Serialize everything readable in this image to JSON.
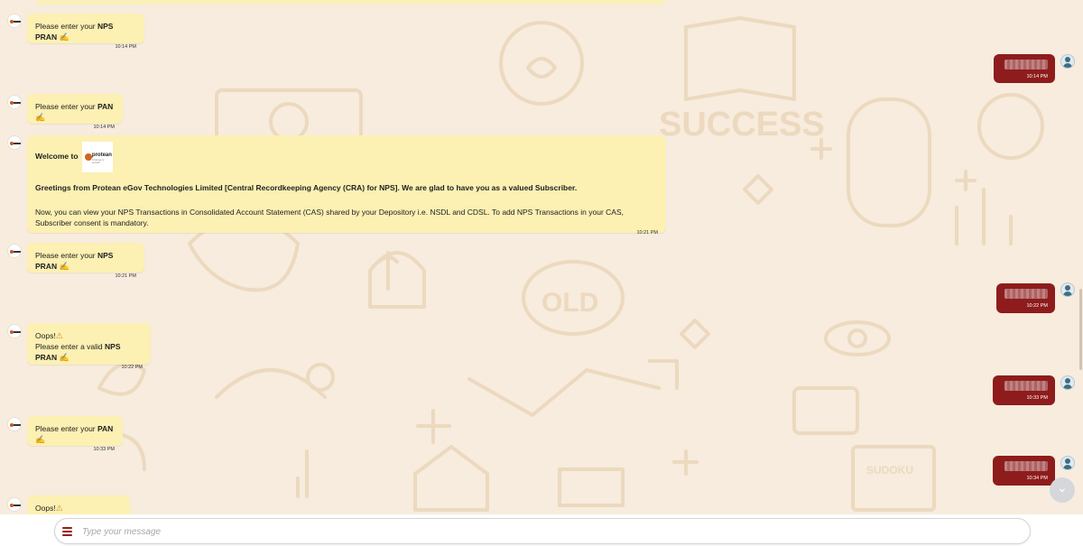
{
  "chat": {
    "messages": [
      {
        "sender": "bot",
        "pre": "Please enter your ",
        "bold": "NPS PRAN",
        "emoji": "✍",
        "time": "10:14 PM"
      },
      {
        "sender": "user",
        "time": "10:14 PM"
      },
      {
        "sender": "bot",
        "pre": "Please enter your ",
        "bold": "PAN",
        "emoji": "✍",
        "time": "10:14 PM"
      },
      {
        "sender": "bot",
        "welcome_text": "Welcome to",
        "logo_text": "protean",
        "logo_sub": "Change is growth",
        "greeting": "Greetings from Protean eGov Technologies Limited [Central Recordkeeping Agency (CRA) for NPS]. We are glad to have you as a valued Subscriber.",
        "body": "Now, you can view your NPS Transactions in Consolidated Account Statement (CAS) shared by your Depository i.e. NSDL and CDSL. To add NPS Transactions in your CAS, Subscriber consent is mandatory.",
        "time": "10:21 PM"
      },
      {
        "sender": "bot",
        "pre": "Please enter your ",
        "bold": "NPS PRAN",
        "emoji": "✍",
        "time": "10:21 PM"
      },
      {
        "sender": "user",
        "time": "10:22 PM"
      },
      {
        "sender": "bot",
        "oops": "Oops!",
        "oops_emoji": "⚠",
        "pre": "Please enter a valid ",
        "bold": "NPS PRAN",
        "emoji": "✍",
        "time": "10:22 PM"
      },
      {
        "sender": "user",
        "time": "10:33 PM"
      },
      {
        "sender": "bot",
        "pre": "Please enter your ",
        "bold": "PAN",
        "emoji": "✍",
        "time": "10:33 PM"
      },
      {
        "sender": "user",
        "time": "10:34 PM"
      },
      {
        "sender": "bot",
        "oops": "Oops!",
        "oops_emoji": "⚠"
      }
    ]
  },
  "background": {
    "word1": "SUCCESS",
    "word2": "OLD",
    "word3": "SUDOKU"
  },
  "composer": {
    "placeholder": "Type your message",
    "menu_icon": "hamburger-menu-icon"
  },
  "scroll": {
    "icon": "chevron-down-icon",
    "glyph": "⌄"
  },
  "colors": {
    "bot_bubble": "#fcf0b3",
    "user_bubble": "#8e1c1c",
    "menu_icon": "#9b1c1c",
    "background": "#f7ecdd"
  }
}
